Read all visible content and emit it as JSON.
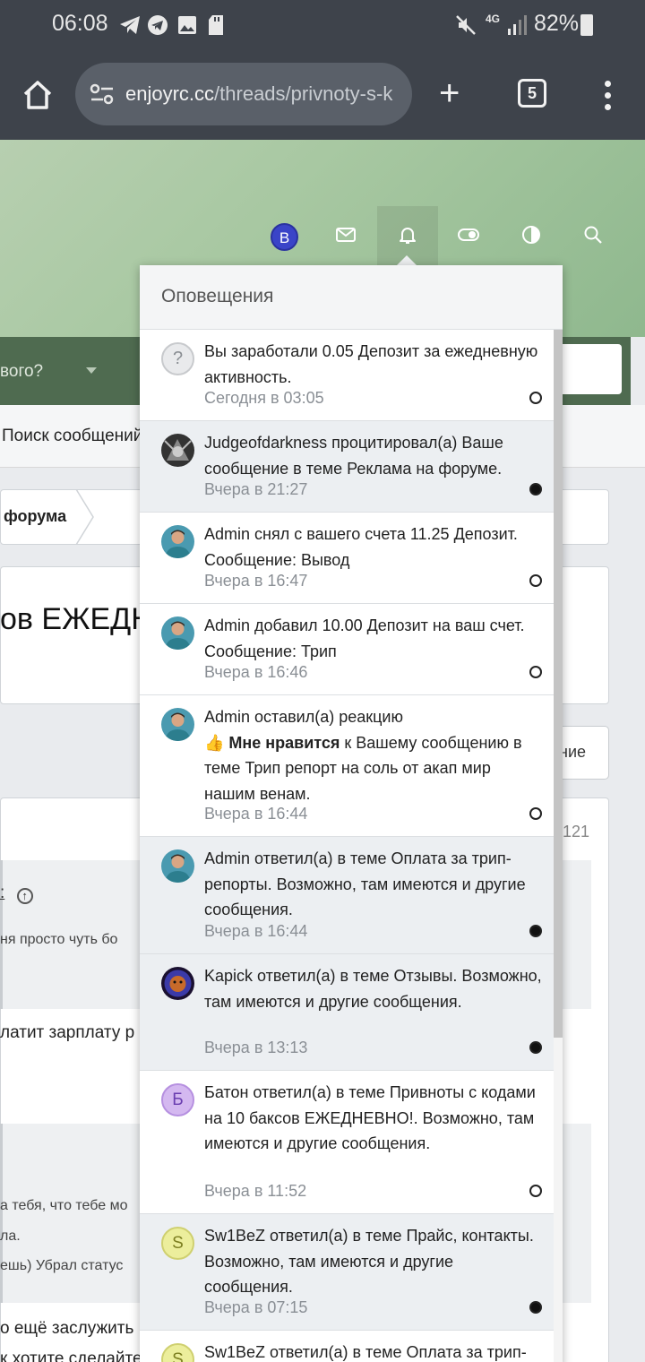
{
  "statusbar": {
    "time": "06:08",
    "icons": [
      "telegram-icon",
      "telegram-icon",
      "image-icon",
      "sd-card-icon"
    ],
    "right_icons": [
      "mute-icon",
      "4g-icon",
      "signal-icon"
    ],
    "battery": "82%"
  },
  "browser": {
    "url_domain": "enjoyrc.cc",
    "url_path": "/threads/privnoty-s-k",
    "tab_count": "5",
    "add_tab_label": "+"
  },
  "site": {
    "nav_text": "вого?",
    "subnav_text": "Поиск сообщений",
    "breadcrumb": "форума",
    "thread_title": "ов ЕЖЕДН",
    "action_button": "ние",
    "post_number": "121",
    "quote1_author": ":",
    "quote1_text": "ня просто чуть бо",
    "body1": "латит зарплату р",
    "quote2_line1": "а тебя, что тебе мо",
    "quote2_line2": "ла.",
    "quote2_line3": "ешь) Убрал статус",
    "body2": "о ещё заслужить",
    "body3": "к хотите сделайте"
  },
  "header": {
    "user_initial": "B",
    "user_avatar_color": "#3a44c8"
  },
  "notifications": {
    "title": "Оповещения",
    "items": [
      {
        "avatar": "?",
        "avatar_type": "question",
        "text": "Вы заработали 0.05 Депозит за ежедневную активность.",
        "time": "Сегодня в 03:05",
        "unread": false
      },
      {
        "avatar": "",
        "avatar_type": "judge",
        "text": "Judgeofdarkness процитировал(а) Ваше сообщение в теме Реклама на форуме.",
        "time": "Вчера в 21:27",
        "unread": true
      },
      {
        "avatar": "",
        "avatar_type": "admin",
        "text": "Admin снял с вашего счета 11.25 Депозит. Сообщение: Вывод",
        "time": "Вчера в 16:47",
        "unread": false
      },
      {
        "avatar": "",
        "avatar_type": "admin",
        "text": "Admin добавил 10.00 Депозит на ваш счет. Сообщение: Трип",
        "time": "Вчера в 16:46",
        "unread": false
      },
      {
        "avatar": "",
        "avatar_type": "admin",
        "text_pre": "Admin оставил(а) реакцию",
        "reaction_emoji": "👍",
        "reaction": "Мне нравится",
        "text_post": "к Вашему сообщению в теме Трип репорт на соль от акап мир нашим венам.",
        "time": "Вчера в 16:44",
        "unread": false
      },
      {
        "avatar": "",
        "avatar_type": "admin",
        "text": "Admin ответил(а) в теме Оплата за трип-репорты. Возможно, там имеются и другие сообщения.",
        "time": "Вчера в 16:44",
        "unread": true
      },
      {
        "avatar": "",
        "avatar_type": "lion",
        "text": "Kapick ответил(а) в теме Отзывы. Возможно, там имеются и другие сообщения.",
        "time": "Вчера в 13:13",
        "unread": true
      },
      {
        "avatar": "Б",
        "avatar_type": "letter-b",
        "text": "Батон ответил(а) в теме Привноты с кодами на 10 баксов ЕЖЕДНЕВНО!. Возможно, там имеются и другие сообщения.",
        "time": "Вчера в 11:52",
        "unread": false
      },
      {
        "avatar": "S",
        "avatar_type": "letter-s",
        "text": "Sw1BeZ ответил(а) в теме Прайс, контакты. Возможно, там имеются и другие сообщения.",
        "time": "Вчера в 07:15",
        "unread": true
      },
      {
        "avatar": "S",
        "avatar_type": "letter-s",
        "text": "Sw1BeZ ответил(а) в теме Оплата за трип-",
        "time": "",
        "unread": false
      }
    ]
  },
  "colors": {
    "chrome_bg": "#3e434b",
    "site_nav": "#4f6b50",
    "hero_green": "#a8c8a2"
  }
}
